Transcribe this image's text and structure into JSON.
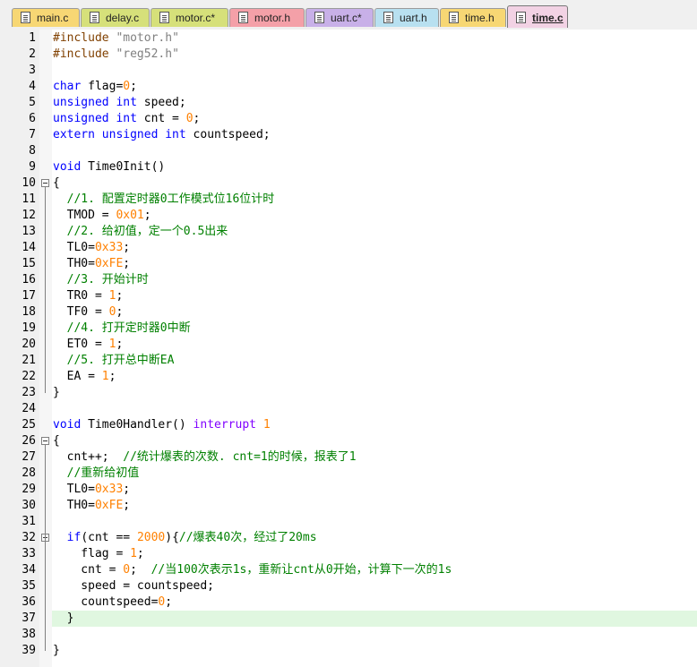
{
  "tabs": [
    {
      "label": "main.c",
      "color": "#f7d774",
      "active": false
    },
    {
      "label": "delay.c",
      "color": "#d6e07a",
      "active": false
    },
    {
      "label": "motor.c*",
      "color": "#d6e07a",
      "active": false
    },
    {
      "label": "motor.h",
      "color": "#f4a0a8",
      "active": false
    },
    {
      "label": "uart.c*",
      "color": "#c8b0e8",
      "active": false
    },
    {
      "label": "uart.h",
      "color": "#b8e0f0",
      "active": false
    },
    {
      "label": "time.h",
      "color": "#f7d774",
      "active": false
    },
    {
      "label": "time.c",
      "color": "#f2d2e4",
      "active": true
    }
  ],
  "editor": {
    "current_line": 37,
    "lines": [
      {
        "n": "1",
        "t": [
          {
            "c": "pp",
            "v": "#include "
          },
          {
            "c": "str",
            "v": "\"motor.h\""
          }
        ]
      },
      {
        "n": "2",
        "t": [
          {
            "c": "pp",
            "v": "#include "
          },
          {
            "c": "str",
            "v": "\"reg52.h\""
          }
        ]
      },
      {
        "n": "3",
        "t": []
      },
      {
        "n": "4",
        "t": [
          {
            "c": "kw",
            "v": "char"
          },
          {
            "c": "",
            "v": " flag="
          },
          {
            "c": "num",
            "v": "0"
          },
          {
            "c": "",
            "v": ";"
          }
        ]
      },
      {
        "n": "5",
        "t": [
          {
            "c": "kw",
            "v": "unsigned int"
          },
          {
            "c": "",
            "v": " speed;"
          }
        ]
      },
      {
        "n": "6",
        "t": [
          {
            "c": "kw",
            "v": "unsigned int"
          },
          {
            "c": "",
            "v": " cnt = "
          },
          {
            "c": "num",
            "v": "0"
          },
          {
            "c": "",
            "v": ";"
          }
        ]
      },
      {
        "n": "7",
        "t": [
          {
            "c": "kw",
            "v": "extern unsigned int"
          },
          {
            "c": "",
            "v": " countspeed;"
          }
        ]
      },
      {
        "n": "8",
        "t": []
      },
      {
        "n": "9",
        "t": [
          {
            "c": "kw",
            "v": "void"
          },
          {
            "c": "",
            "v": " Time0Init()"
          }
        ]
      },
      {
        "n": "10",
        "fold": "open",
        "t": [
          {
            "c": "",
            "v": "{"
          }
        ]
      },
      {
        "n": "11",
        "t": [
          {
            "c": "",
            "v": "  "
          },
          {
            "c": "cmt",
            "v": "//1. 配置定时器0工作模式位16位计时"
          }
        ]
      },
      {
        "n": "12",
        "t": [
          {
            "c": "",
            "v": "  TMOD = "
          },
          {
            "c": "num",
            "v": "0x01"
          },
          {
            "c": "",
            "v": ";"
          }
        ]
      },
      {
        "n": "13",
        "t": [
          {
            "c": "",
            "v": "  "
          },
          {
            "c": "cmt",
            "v": "//2. 给初值，定一个0.5出来"
          }
        ]
      },
      {
        "n": "14",
        "t": [
          {
            "c": "",
            "v": "  TL0="
          },
          {
            "c": "num",
            "v": "0x33"
          },
          {
            "c": "",
            "v": ";"
          }
        ]
      },
      {
        "n": "15",
        "t": [
          {
            "c": "",
            "v": "  TH0="
          },
          {
            "c": "num",
            "v": "0xFE"
          },
          {
            "c": "",
            "v": ";"
          }
        ]
      },
      {
        "n": "16",
        "t": [
          {
            "c": "",
            "v": "  "
          },
          {
            "c": "cmt",
            "v": "//3. 开始计时"
          }
        ]
      },
      {
        "n": "17",
        "t": [
          {
            "c": "",
            "v": "  TR0 = "
          },
          {
            "c": "num",
            "v": "1"
          },
          {
            "c": "",
            "v": ";"
          }
        ]
      },
      {
        "n": "18",
        "t": [
          {
            "c": "",
            "v": "  TF0 = "
          },
          {
            "c": "num",
            "v": "0"
          },
          {
            "c": "",
            "v": ";"
          }
        ]
      },
      {
        "n": "19",
        "t": [
          {
            "c": "",
            "v": "  "
          },
          {
            "c": "cmt",
            "v": "//4. 打开定时器0中断"
          }
        ]
      },
      {
        "n": "20",
        "t": [
          {
            "c": "",
            "v": "  ET0 = "
          },
          {
            "c": "num",
            "v": "1"
          },
          {
            "c": "",
            "v": ";"
          }
        ]
      },
      {
        "n": "21",
        "t": [
          {
            "c": "",
            "v": "  "
          },
          {
            "c": "cmt",
            "v": "//5. 打开总中断EA"
          }
        ]
      },
      {
        "n": "22",
        "t": [
          {
            "c": "",
            "v": "  EA = "
          },
          {
            "c": "num",
            "v": "1"
          },
          {
            "c": "",
            "v": ";"
          }
        ]
      },
      {
        "n": "23",
        "t": [
          {
            "c": "",
            "v": "}"
          }
        ]
      },
      {
        "n": "24",
        "t": []
      },
      {
        "n": "25",
        "t": [
          {
            "c": "kw",
            "v": "void"
          },
          {
            "c": "",
            "v": " Time0Handler() "
          },
          {
            "c": "intr",
            "v": "interrupt"
          },
          {
            "c": "",
            "v": " "
          },
          {
            "c": "num",
            "v": "1"
          }
        ]
      },
      {
        "n": "26",
        "fold": "open",
        "t": [
          {
            "c": "",
            "v": "{"
          }
        ]
      },
      {
        "n": "27",
        "t": [
          {
            "c": "",
            "v": "  cnt++;  "
          },
          {
            "c": "cmt",
            "v": "//统计爆表的次数. cnt=1的时候，报表了1"
          }
        ]
      },
      {
        "n": "28",
        "t": [
          {
            "c": "",
            "v": "  "
          },
          {
            "c": "cmt",
            "v": "//重新给初值"
          }
        ]
      },
      {
        "n": "29",
        "t": [
          {
            "c": "",
            "v": "  TL0="
          },
          {
            "c": "num",
            "v": "0x33"
          },
          {
            "c": "",
            "v": ";"
          }
        ]
      },
      {
        "n": "30",
        "t": [
          {
            "c": "",
            "v": "  TH0="
          },
          {
            "c": "num",
            "v": "0xFE"
          },
          {
            "c": "",
            "v": ";"
          }
        ]
      },
      {
        "n": "31",
        "t": []
      },
      {
        "n": "32",
        "fold": "open",
        "t": [
          {
            "c": "",
            "v": "  "
          },
          {
            "c": "kw",
            "v": "if"
          },
          {
            "c": "",
            "v": "(cnt == "
          },
          {
            "c": "num",
            "v": "2000"
          },
          {
            "c": "",
            "v": "){"
          },
          {
            "c": "cmt",
            "v": "//爆表40次，经过了20ms"
          }
        ]
      },
      {
        "n": "33",
        "t": [
          {
            "c": "",
            "v": "    flag = "
          },
          {
            "c": "num",
            "v": "1"
          },
          {
            "c": "",
            "v": ";"
          }
        ]
      },
      {
        "n": "34",
        "t": [
          {
            "c": "",
            "v": "    cnt = "
          },
          {
            "c": "num",
            "v": "0"
          },
          {
            "c": "",
            "v": ";  "
          },
          {
            "c": "cmt",
            "v": "//当100次表示1s，重新让cnt从0开始，计算下一次的1s"
          }
        ]
      },
      {
        "n": "35",
        "t": [
          {
            "c": "",
            "v": "    speed = countspeed;"
          }
        ]
      },
      {
        "n": "36",
        "t": [
          {
            "c": "",
            "v": "    countspeed="
          },
          {
            "c": "num",
            "v": "0"
          },
          {
            "c": "",
            "v": ";"
          }
        ]
      },
      {
        "n": "37",
        "t": [
          {
            "c": "",
            "v": "  }"
          }
        ]
      },
      {
        "n": "38",
        "t": []
      },
      {
        "n": "39",
        "t": [
          {
            "c": "",
            "v": "}"
          }
        ]
      }
    ]
  }
}
